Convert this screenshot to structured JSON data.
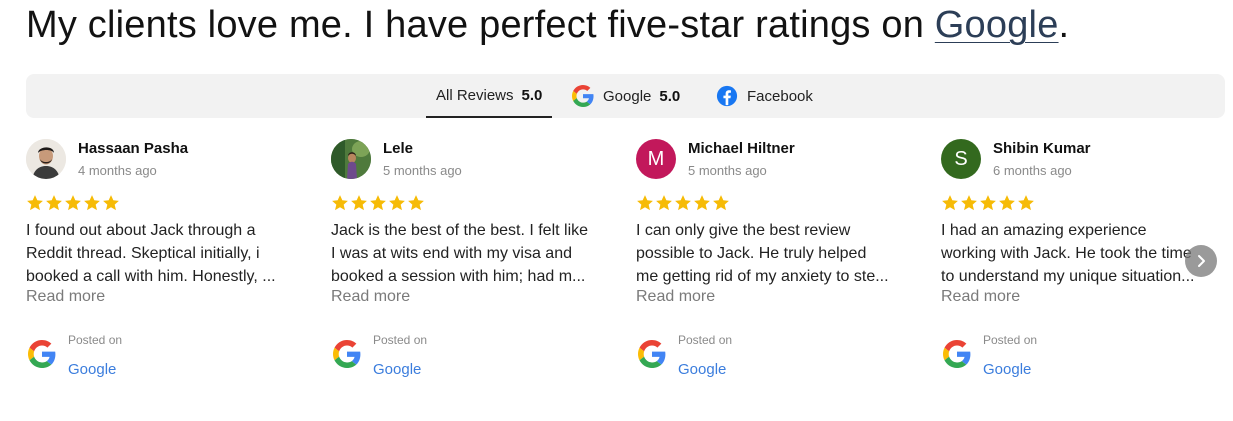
{
  "headline": {
    "text": "My clients love me.  I have perfect five-star ratings on ",
    "link_text": "Google",
    "end": "."
  },
  "tabs": [
    {
      "label": "All Reviews",
      "score": "5.0",
      "icon": "none"
    },
    {
      "label": "Google",
      "score": "5.0",
      "icon": "google-icon"
    },
    {
      "label": "Facebook",
      "score": "",
      "icon": "facebook-icon"
    }
  ],
  "colors": {
    "star": "#f6bb06",
    "avatar_michael": "#c2185b",
    "avatar_shibin": "#33691e",
    "link": "#3b7ddd",
    "facebook": "#1877f2"
  },
  "reviews": [
    {
      "name": "Hassaan Pasha",
      "date": "4 months ago",
      "rating": 5,
      "avatar": {
        "type": "photo",
        "letter": ""
      },
      "lines": [
        "I found out about Jack through a",
        "Reddit thread. Skeptical initially, i",
        "booked a call with him. Honestly, ..."
      ],
      "read_more": "Read more",
      "posted_on": "Posted on",
      "source": "Google"
    },
    {
      "name": "Lele",
      "date": "5 months ago",
      "rating": 5,
      "avatar": {
        "type": "photo",
        "letter": ""
      },
      "lines": [
        "Jack is the best of the best. I felt like",
        "I was at wits end with my visa and",
        "booked a session with him; had m..."
      ],
      "read_more": "Read more",
      "posted_on": "Posted on",
      "source": "Google"
    },
    {
      "name": "Michael Hiltner",
      "date": "5 months ago",
      "rating": 5,
      "avatar": {
        "type": "letter",
        "letter": "M"
      },
      "lines": [
        "I can only give the best review",
        "possible to Jack. He truly helped",
        "me getting rid of my anxiety to ste..."
      ],
      "read_more": "Read more",
      "posted_on": "Posted on",
      "source": "Google"
    },
    {
      "name": "Shibin Kumar",
      "date": "6 months ago",
      "rating": 5,
      "avatar": {
        "type": "letter",
        "letter": "S"
      },
      "lines": [
        "I had an amazing experience",
        "working with Jack. He took the time",
        "to understand my unique situation..."
      ],
      "read_more": "Read more",
      "posted_on": "Posted on",
      "source": "Google"
    }
  ],
  "carousel": {
    "next_icon": "chevron-right-icon"
  }
}
